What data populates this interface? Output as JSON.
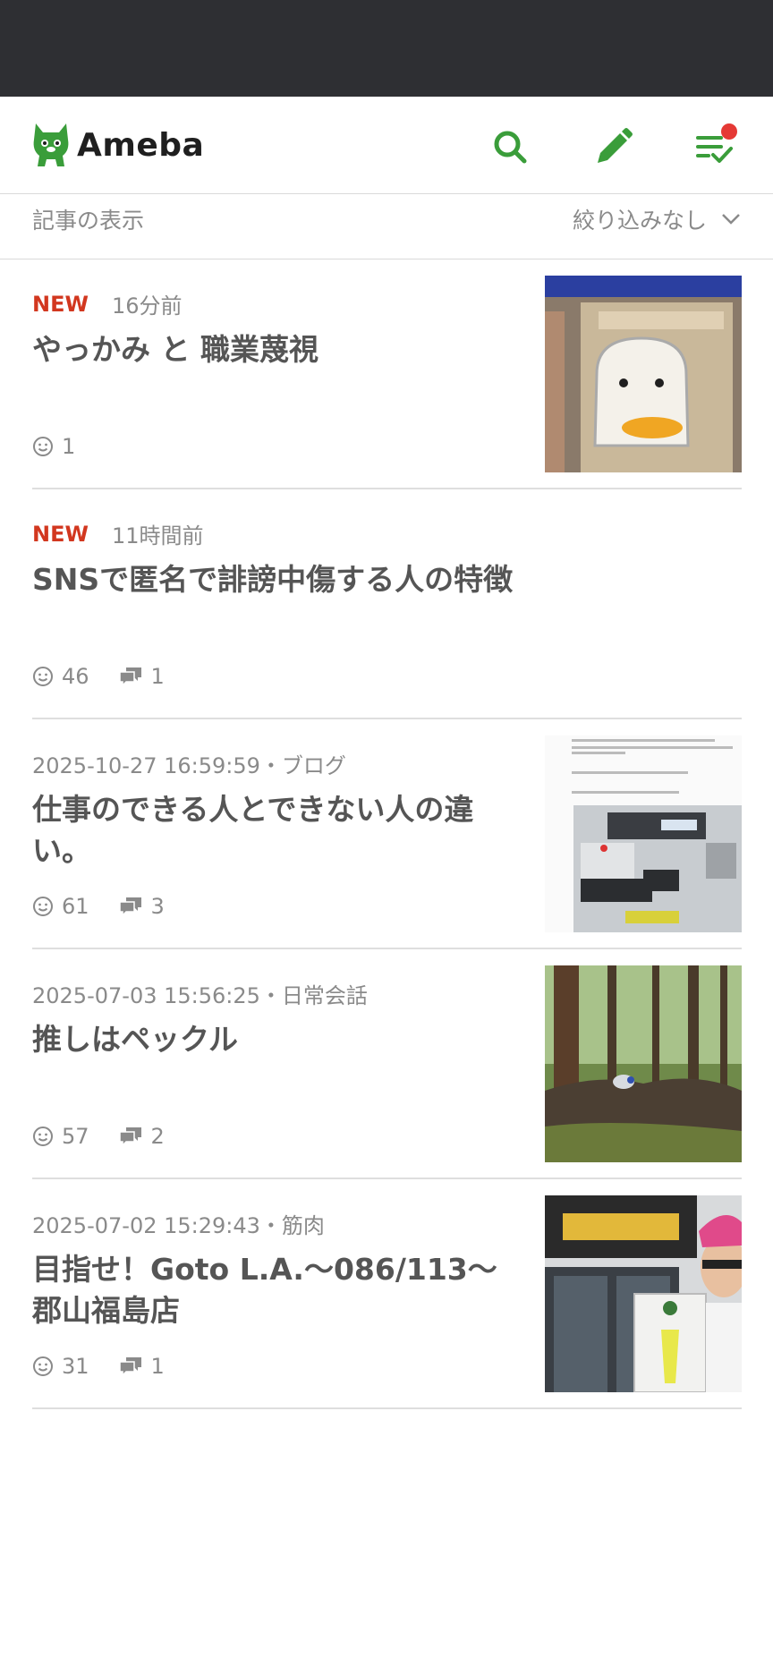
{
  "app": {
    "logo_text": "Ameba",
    "accent_color": "#3a9d3a",
    "new_color": "#d2371f"
  },
  "header": {
    "icons": [
      "search-icon",
      "edit-pencil-icon",
      "notification-list-icon"
    ]
  },
  "filter": {
    "label": "記事の表示",
    "value": "絞り込みなし"
  },
  "entries": [
    {
      "badge": "NEW",
      "time": "16分前",
      "title": "やっかみ と 職業蔑視",
      "likes": "1",
      "comments": ""
    },
    {
      "badge": "NEW",
      "time": "11時間前",
      "title": "SNSで匿名で誹謗中傷する人の特徴",
      "likes": "46",
      "comments": "1"
    },
    {
      "badge": "",
      "time": "2025-10-27 16:59:59・ブログ",
      "title": "仕事のできる人とできない人の違い。",
      "likes": "61",
      "comments": "3"
    },
    {
      "badge": "",
      "time": "2025-07-03 15:56:25・日常会話",
      "title": "推しはペックル",
      "likes": "57",
      "comments": "2"
    },
    {
      "badge": "",
      "time": "2025-07-02 15:29:43・筋肉",
      "title": "目指せ！Goto L.A.〜086/113〜郡山福島店",
      "likes": "31",
      "comments": "1"
    }
  ]
}
